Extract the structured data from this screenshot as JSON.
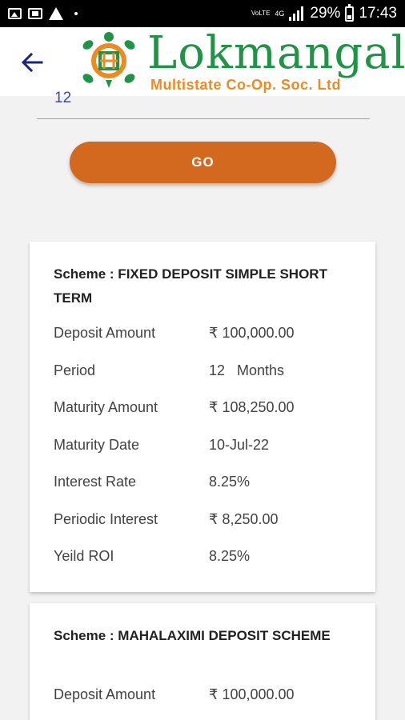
{
  "status_bar": {
    "left_icons": [
      "image-icon",
      "gallery-icon",
      "warning-icon",
      "dot-icon"
    ],
    "volte": "VoLTE",
    "network": "4G",
    "battery": "29%",
    "time": "17:43"
  },
  "header": {
    "brand_name": "Lokmangal",
    "brand_sub": "Multistate Co-Op. Soc. Ltd"
  },
  "form": {
    "period_value": "12",
    "go_label": "GO"
  },
  "schemes": [
    {
      "title": "Scheme : FIXED DEPOSIT SIMPLE SHORT TERM",
      "rows": [
        {
          "label": "Deposit Amount",
          "value": "₹ 100,000.00"
        },
        {
          "label": "Period",
          "value": "12   Months"
        },
        {
          "label": "Maturity Amount",
          "value": "₹ 108,250.00"
        },
        {
          "label": "Maturity Date",
          "value": "10-Jul-22"
        },
        {
          "label": "Interest Rate",
          "value": "8.25%"
        },
        {
          "label": "Periodic Interest",
          "value": "₹ 8,250.00"
        },
        {
          "label": "Yeild ROI",
          "value": "8.25%"
        }
      ]
    },
    {
      "title": "Scheme : MAHALAXIMI DEPOSIT SCHEME",
      "rows": [
        {
          "label": "Deposit Amount",
          "value": "₹ 100,000.00"
        }
      ]
    }
  ],
  "colors": {
    "brand_green": "#1f9446",
    "brand_orange": "#f08a1e",
    "button": "#d2691e",
    "back_arrow": "#1a237e"
  }
}
